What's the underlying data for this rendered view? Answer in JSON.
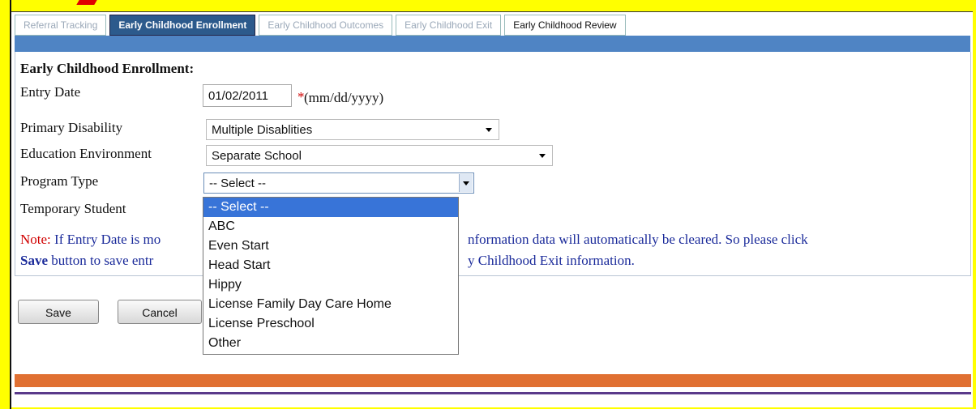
{
  "tabs": [
    {
      "label": "Referral Tracking"
    },
    {
      "label": "Early Childhood Enrollment"
    },
    {
      "label": "Early Childhood Outcomes"
    },
    {
      "label": "Early Childhood Exit"
    },
    {
      "label": "Early Childhood Review"
    }
  ],
  "form": {
    "section_title": "Early Childhood Enrollment:",
    "entry_date_label": "Entry Date",
    "entry_date_value": "01/02/2011",
    "required_mark": "*",
    "date_hint": "(mm/dd/yyyy)",
    "primary_disability_label": "Primary Disability",
    "primary_disability_value": "Multiple Disablities",
    "education_environment_label": "Education Environment",
    "education_environment_value": "Separate School",
    "program_type_label": "Program Type",
    "program_type_value": "-- Select --",
    "temporary_student_label": "Temporary Student"
  },
  "note": {
    "prefix": "Note:",
    "line1_start": "If Entry Date is mo",
    "line1_end": "nformation data will automatically be cleared. So please click",
    "save_word": "Save",
    "line2_start": "button to save entr",
    "line2_end": "y Childhood Exit information."
  },
  "buttons": {
    "save": "Save",
    "cancel": "Cancel"
  },
  "program_type_options": [
    "-- Select --",
    "ABC",
    "Even Start",
    "Head Start",
    "Hippy",
    "License Family Day Care Home",
    "License Preschool",
    "Other"
  ],
  "colors": {
    "accent_blue": "#4f84c4",
    "active_tab": "#2c5a8c",
    "orange_bar": "#e07032",
    "highlight_border": "#ffff00"
  }
}
